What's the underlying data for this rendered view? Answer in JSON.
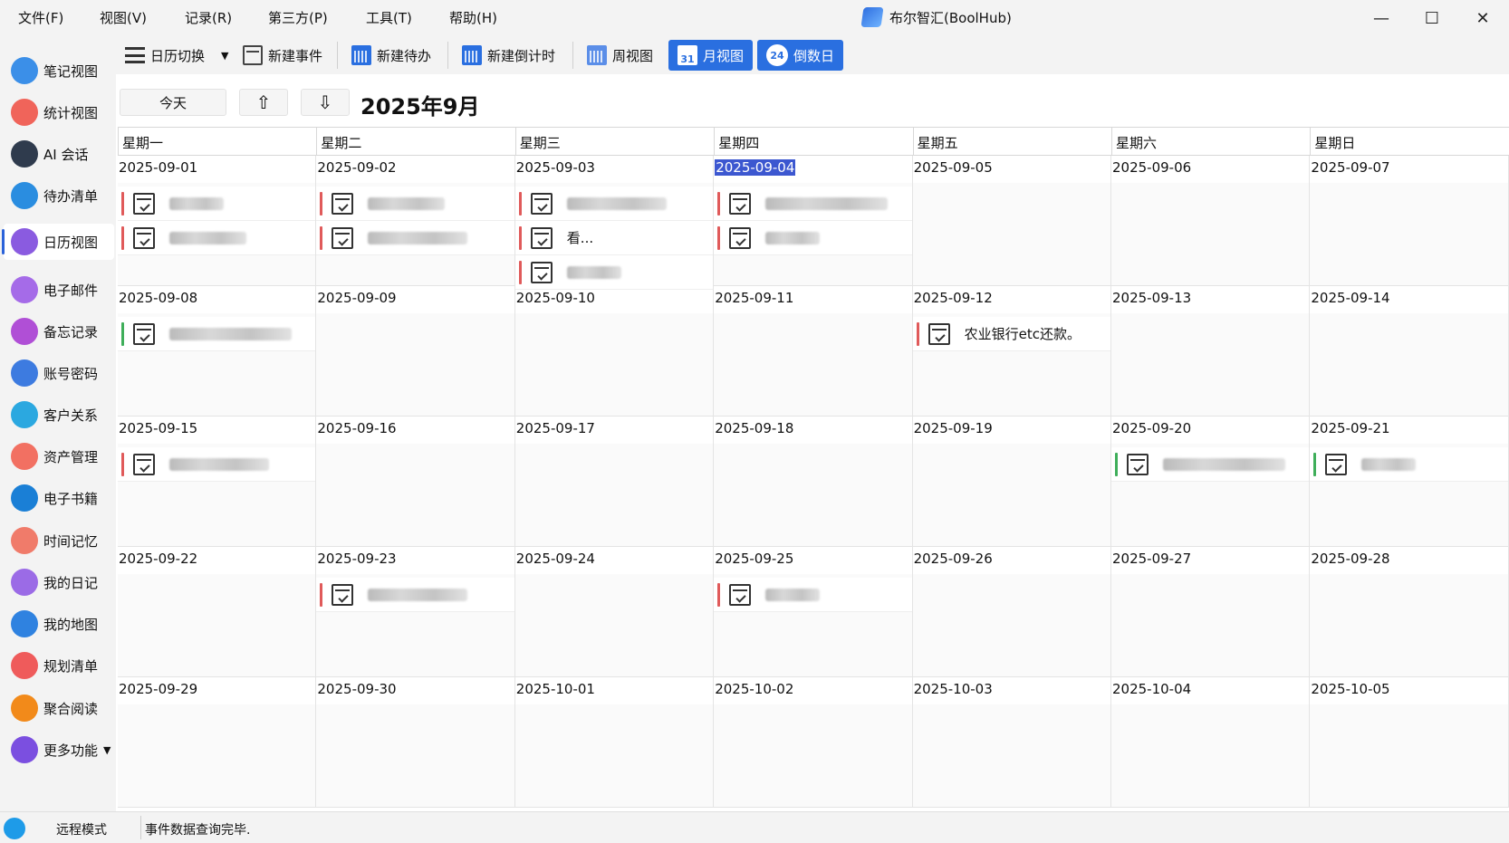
{
  "menu": [
    "文件(F)",
    "视图(V)",
    "记录(R)",
    "第三方(P)",
    "工具(T)",
    "帮助(H)"
  ],
  "app_title": "布尔智汇(BoolHub)",
  "window_controls": {
    "minimize": "—",
    "maximize": "☐",
    "close": "✕"
  },
  "sidebar": [
    {
      "label": "笔记视图",
      "icon": "cloud-icon",
      "color": "#3b8fe8"
    },
    {
      "label": "统计视图",
      "icon": "chart-icon",
      "color": "#f0645a"
    },
    {
      "label": "AI 会话",
      "icon": "robot-icon",
      "color": "#2f3b4d"
    },
    {
      "label": "待办清单",
      "icon": "todo-icon",
      "color": "#2a8de0"
    },
    {
      "label": "日历视图",
      "icon": "calendar-icon",
      "color": "#8a5be0",
      "active": true
    },
    {
      "label": "电子邮件",
      "icon": "mail-icon",
      "color": "#a56be8"
    },
    {
      "label": "备忘记录",
      "icon": "memo-icon",
      "color": "#b04fd6"
    },
    {
      "label": "账号密码",
      "icon": "key-icon",
      "color": "#3d7be0"
    },
    {
      "label": "客户关系",
      "icon": "people-icon",
      "color": "#2ba8e0"
    },
    {
      "label": "资产管理",
      "icon": "home-icon",
      "color": "#f27062"
    },
    {
      "label": "电子书籍",
      "icon": "book-icon",
      "color": "#1a7fd6"
    },
    {
      "label": "时间记忆",
      "icon": "memory-icon",
      "color": "#f07b6a"
    },
    {
      "label": "我的日记",
      "icon": "diary-icon",
      "color": "#9b6be6"
    },
    {
      "label": "我的地图",
      "icon": "map-icon",
      "color": "#2f82e0"
    },
    {
      "label": "规划清单",
      "icon": "plan-icon",
      "color": "#ef5b5b"
    },
    {
      "label": "聚合阅读",
      "icon": "rss-icon",
      "color": "#f28a1a"
    },
    {
      "label": "更多功能",
      "icon": "more-icon",
      "color": "#7b4fe0"
    }
  ],
  "toolbar": {
    "calendar_switch": "日历切换",
    "new_event": "新建事件",
    "new_todo": "新建待办",
    "new_countdown": "新建倒计时",
    "week_view": "周视图",
    "month_view": "月视图",
    "month_view_icon_text": "31",
    "countdown_days": "倒数日",
    "countdown_icon_text": "24"
  },
  "nav": {
    "today": "今天",
    "up": "⇧",
    "down": "⇩",
    "month_title": "2025年9月"
  },
  "weekdays": [
    "星期一",
    "星期二",
    "星期三",
    "星期四",
    "星期五",
    "星期六",
    "星期日"
  ],
  "weeks": [
    [
      "2025-09-01",
      "2025-09-02",
      "2025-09-03",
      "2025-09-04",
      "2025-09-05",
      "2025-09-06",
      "2025-09-07"
    ],
    [
      "2025-09-08",
      "2025-09-09",
      "2025-09-10",
      "2025-09-11",
      "2025-09-12",
      "2025-09-13",
      "2025-09-14"
    ],
    [
      "2025-09-15",
      "2025-09-16",
      "2025-09-17",
      "2025-09-18",
      "2025-09-19",
      "2025-09-20",
      "2025-09-21"
    ],
    [
      "2025-09-22",
      "2025-09-23",
      "2025-09-24",
      "2025-09-25",
      "2025-09-26",
      "2025-09-27",
      "2025-09-28"
    ],
    [
      "2025-09-29",
      "2025-09-30",
      "2025-10-01",
      "2025-10-02",
      "2025-10-03",
      "2025-10-04",
      "2025-10-05"
    ]
  ],
  "selected_date": "2025-09-04",
  "events": {
    "2025-09-01": [
      {
        "text": "",
        "color": "#e05a5a"
      },
      {
        "text": "",
        "color": "#e05a5a"
      }
    ],
    "2025-09-02": [
      {
        "text": "",
        "color": "#e05a5a"
      },
      {
        "text": "",
        "color": "#e05a5a"
      }
    ],
    "2025-09-03": [
      {
        "text": "",
        "color": "#e05a5a"
      },
      {
        "text": "看...",
        "color": "#e05a5a"
      },
      {
        "text": "",
        "color": "#e05a5a"
      }
    ],
    "2025-09-04": [
      {
        "text": "",
        "color": "#e05a5a"
      },
      {
        "text": "",
        "color": "#e05a5a"
      }
    ],
    "2025-09-08": [
      {
        "text": "",
        "color": "#3fae5a"
      }
    ],
    "2025-09-12": [
      {
        "text": "农业银行etc还款。",
        "color": "#e05a5a"
      }
    ],
    "2025-09-15": [
      {
        "text": "",
        "color": "#e05a5a"
      }
    ],
    "2025-09-20": [
      {
        "text": "",
        "color": "#3fae5a"
      }
    ],
    "2025-09-21": [
      {
        "text": "",
        "color": "#3fae5a"
      }
    ],
    "2025-09-23": [
      {
        "text": "",
        "color": "#e05a5a"
      }
    ],
    "2025-09-25": [
      {
        "text": "",
        "color": "#e05a5a"
      }
    ]
  },
  "status": {
    "mode": "远程模式",
    "message": "事件数据查询完毕."
  }
}
